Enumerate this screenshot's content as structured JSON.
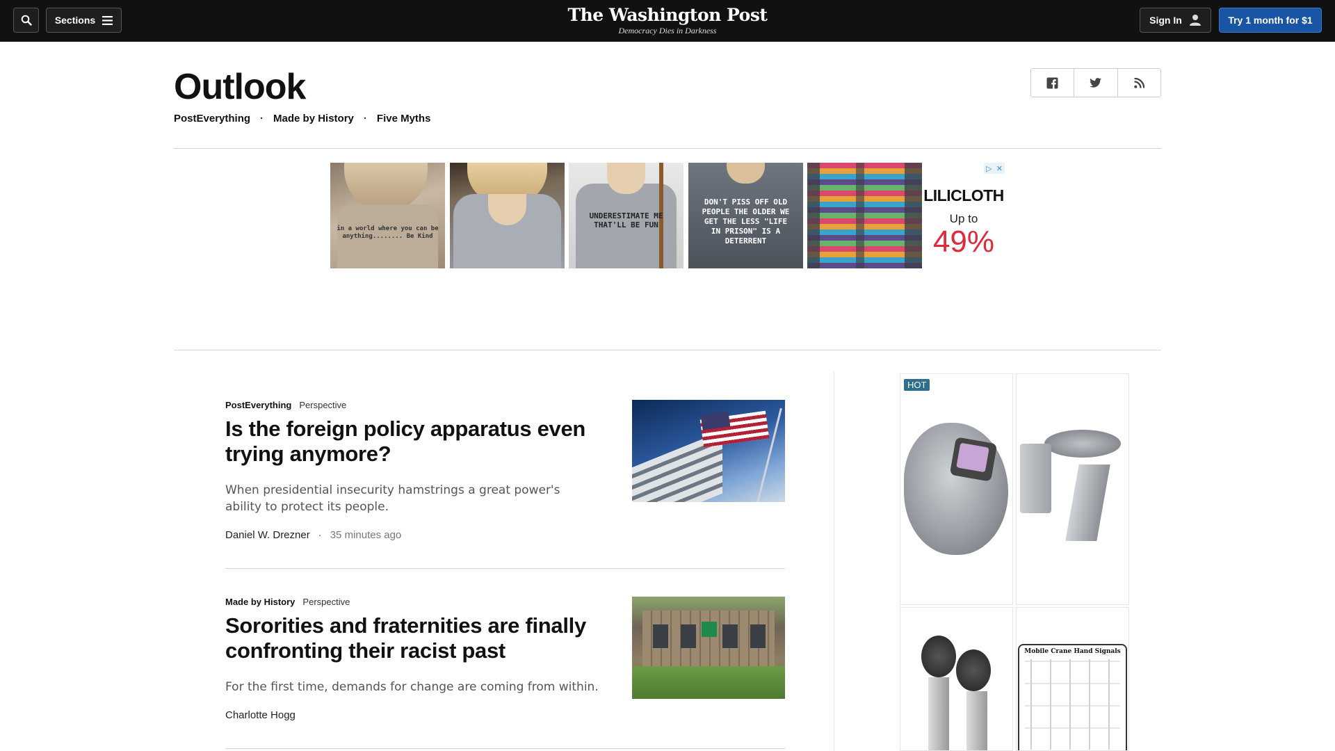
{
  "topbar": {
    "sections_label": "Sections",
    "logo": "The Washington Post",
    "tagline": "Democracy Dies in Darkness",
    "signin_label": "Sign In",
    "trial_label": "Try 1 month for $1",
    "trial_color": "#1955a5"
  },
  "header": {
    "title": "Outlook",
    "subnav": [
      "PostEverything",
      "Made by History",
      "Five Myths"
    ],
    "social_icons": [
      "facebook-icon",
      "twitter-icon",
      "rss-icon"
    ]
  },
  "top_ad": {
    "tiles": [
      {
        "text": "in a world where you can be anything........ Be Kind"
      },
      {
        "text": ""
      },
      {
        "text": "UNDERESTIMATE ME THAT'LL BE FUN"
      },
      {
        "text": "DON'T PISS OFF OLD PEOPLE THE OLDER WE GET THE LESS \"LIFE IN PRISON\" IS A DETERRENT"
      },
      {
        "text": ""
      }
    ],
    "brand": "LILICLOTH",
    "brand_offer_line1": "Up to",
    "brand_offer_line2": "49%"
  },
  "articles": [
    {
      "kicker": "PostEverything",
      "label": "Perspective",
      "headline": "Is the foreign policy apparatus even trying anymore?",
      "blurb": "When presidential insecurity hamstrings a great power's ability to protect its people.",
      "author": "Daniel W. Drezner",
      "time": "35 minutes ago"
    },
    {
      "kicker": "Made by History",
      "label": "Perspective",
      "headline": "Sororities and fraternities are finally confronting their racist past",
      "blurb": "For the first time, demands for change are coming from within.",
      "author": "Charlotte Hogg",
      "time": ""
    }
  ],
  "side_ad": {
    "badge": "HOT",
    "crane_title": "Mobile Crane Hand Signals"
  }
}
